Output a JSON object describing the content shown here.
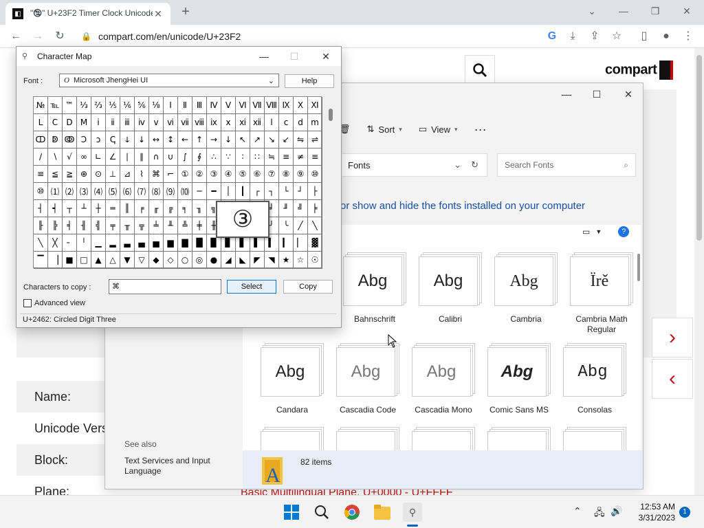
{
  "browser": {
    "tab_title": "\"🕲\" U+23F2 Timer Clock Unicode",
    "url": "compart.com/en/unicode/U+23F2"
  },
  "webpage": {
    "brand": "compart",
    "info_labels": [
      "Name:",
      "Unicode Vers",
      "Block:",
      "Plane:"
    ],
    "plane_value": "Basic Multilingual Plane, U+0000 - U+FFFF"
  },
  "fonts_window": {
    "commands": {
      "sort": "Sort",
      "view": "View"
    },
    "address": "Fonts",
    "search_placeholder": "Search Fonts",
    "heading": "or show and hide the fonts installed on your computer",
    "fonts": [
      {
        "preview": "Abg",
        "name": "Bahnschrift"
      },
      {
        "preview": "Abg",
        "name": "Calibri"
      },
      {
        "preview": "Abg",
        "name": "Cambria"
      },
      {
        "preview": "Ïrě",
        "name": "Cambria Math Regular"
      },
      {
        "preview": "Abg",
        "name": "Candara"
      },
      {
        "preview": "Abg",
        "name": "Cascadia Code"
      },
      {
        "preview": "Abg",
        "name": "Cascadia Mono"
      },
      {
        "preview": "Abg",
        "name": "Comic Sans MS"
      },
      {
        "preview": "Abg",
        "name": "Consolas"
      }
    ],
    "see_also": "See also",
    "see_also_link": "Text Services and Input Language",
    "item_count": "82 items"
  },
  "charmap": {
    "title": "Character Map",
    "font_label": "Font :",
    "font_value": "Microsoft JhengHei UI",
    "help": "Help",
    "chars": [
      "№",
      "℡",
      "™",
      "⅓",
      "⅔",
      "⅕",
      "⅙",
      "⅚",
      "⅛",
      "Ⅰ",
      "Ⅱ",
      "Ⅲ",
      "Ⅳ",
      "Ⅴ",
      "Ⅵ",
      "Ⅶ",
      "Ⅷ",
      "Ⅸ",
      "Ⅹ",
      "Ⅺ",
      "Ⅼ",
      "Ⅽ",
      "Ⅾ",
      "Ⅿ",
      "ⅰ",
      "ⅱ",
      "ⅲ",
      "ⅳ",
      "ⅴ",
      "ⅵ",
      "ⅶ",
      "ⅷ",
      "ⅸ",
      "ⅹ",
      "ⅺ",
      "ⅻ",
      "ⅼ",
      "ⅽ",
      "ⅾ",
      "ⅿ",
      "ↀ",
      "ↁ",
      "ↂ",
      "Ↄ",
      "ↄ",
      "ↅ",
      "ↆ",
      "↓",
      "↔",
      "↕",
      "←",
      "↑",
      "→",
      "↓",
      "↖",
      "↗",
      "↘",
      "↙",
      "⇋",
      "⇌",
      "∕",
      "∖",
      "√",
      "∞",
      "∟",
      "∠",
      "∣",
      "∥",
      "∩",
      "∪",
      "∫",
      "∮",
      "∴",
      "∵",
      "∶",
      "∷",
      "≒",
      "≡",
      "≠",
      "≡",
      "≡",
      "≦",
      "≧",
      "⊕",
      "⊙",
      "⊥",
      "⊿",
      "⌇",
      "⌘",
      "⌐",
      "①",
      "②",
      "③",
      "④",
      "⑤",
      "⑥",
      "⑦",
      "⑧",
      "⑨",
      "⑩",
      "⑩",
      "⑴",
      "⑵",
      "⑶",
      "⑷",
      "⑸",
      "⑹",
      "⑺",
      "⑻",
      "⑼",
      "⑽",
      "─",
      "━",
      "│",
      "┃",
      "┌",
      "┐",
      "└",
      "┘",
      "├",
      "┤",
      "┥",
      "┬",
      "┴",
      "┼",
      "═",
      "║",
      "╒",
      "╓",
      "╔",
      "╕",
      "╖",
      "╗",
      "╘",
      "╙",
      "╚",
      "╛",
      "╜",
      "╝",
      "╞",
      "╟",
      "╠",
      "╡",
      "╢",
      "╣",
      "╤",
      "╥",
      "╦",
      "╧",
      "╨",
      "╩",
      "╪",
      "╫",
      "╬",
      "╭",
      "╮",
      "╯",
      "╰",
      "╱",
      "╲",
      "╲",
      "╳",
      "╴",
      "╵",
      "▁",
      "▂",
      "▃",
      "▄",
      "▅",
      "▆",
      "▇",
      "█",
      "▉",
      "▊",
      "▋",
      "▌",
      "▍",
      "▎",
      "▏",
      "▓",
      "▔",
      "▕",
      "■",
      "□",
      "▲",
      "△",
      "▼",
      "▽",
      "◆",
      "◇",
      "○",
      "◎",
      "●",
      "◢",
      "◣",
      "◤",
      "◥",
      "★",
      "☆",
      "☉"
    ],
    "zoom_char": "③",
    "copy_label": "Characters to copy :",
    "copy_value": "⌘",
    "select": "Select",
    "copy": "Copy",
    "advanced": "Advanced view",
    "status": "U+2462: Circled Digit Three"
  },
  "taskbar": {
    "time": "12:53 AM",
    "date": "3/31/2023",
    "notifications": "1"
  }
}
